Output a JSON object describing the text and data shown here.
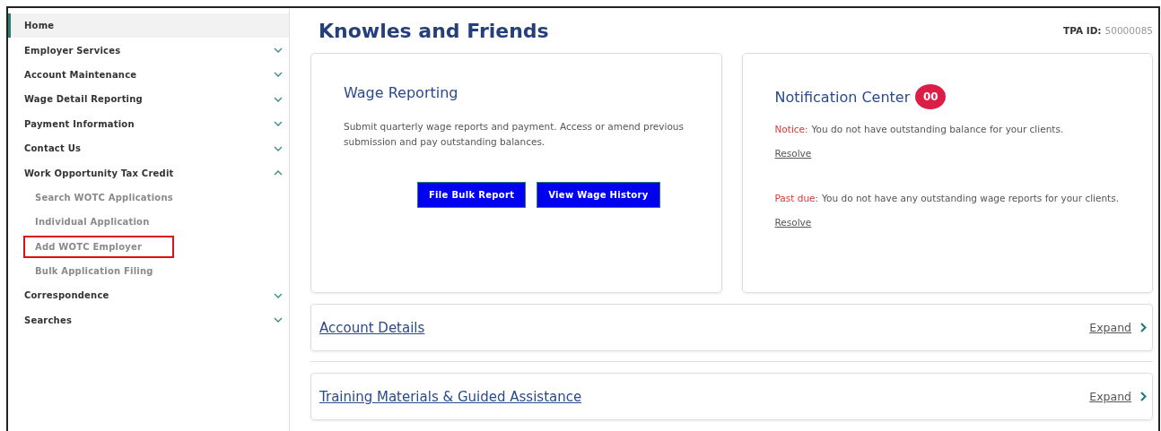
{
  "sidebar": {
    "items": [
      {
        "label": "Home",
        "selected": true
      },
      {
        "label": "Employer Services",
        "selected": false,
        "expanded": false
      },
      {
        "label": "Account Maintenance",
        "selected": false,
        "expanded": false
      },
      {
        "label": "Wage Detail Reporting",
        "selected": false,
        "expanded": false
      },
      {
        "label": "Payment Information",
        "selected": false,
        "expanded": false
      },
      {
        "label": "Contact Us",
        "selected": false,
        "expanded": false
      },
      {
        "label": "Work Opportunity Tax Credit",
        "selected": false,
        "expanded": true,
        "children": [
          {
            "label": "Search WOTC Applications",
            "highlighted": false
          },
          {
            "label": "Individual Application",
            "highlighted": false
          },
          {
            "label": "Add WOTC Employer",
            "highlighted": true
          },
          {
            "label": "Bulk Application Filing",
            "highlighted": false
          }
        ]
      },
      {
        "label": "Correspondence",
        "selected": false,
        "expanded": false
      },
      {
        "label": "Searches",
        "selected": false,
        "expanded": false
      }
    ]
  },
  "header": {
    "title": "Knowles and Friends",
    "tpa_label": "TPA ID:",
    "tpa_value": "50000085"
  },
  "wage_card": {
    "title": "Wage Reporting",
    "description": "Submit quarterly wage reports and payment. Access or amend previous submission and pay outstanding balances.",
    "buttons": [
      "File Bulk Report",
      "View Wage History"
    ]
  },
  "notification_card": {
    "title": "Notification Center",
    "badge": "00",
    "notices": [
      {
        "label": "Notice:",
        "text": "You do not have outstanding balance for your clients.",
        "link": "Resolve"
      },
      {
        "label": "Past due:",
        "text": "You do not have any outstanding wage reports for your clients.",
        "link": "Resolve"
      }
    ]
  },
  "sections": [
    {
      "title": "Account Details",
      "action": "Expand"
    },
    {
      "title": "Training Materials & Guided Assistance",
      "action": "Expand"
    }
  ]
}
